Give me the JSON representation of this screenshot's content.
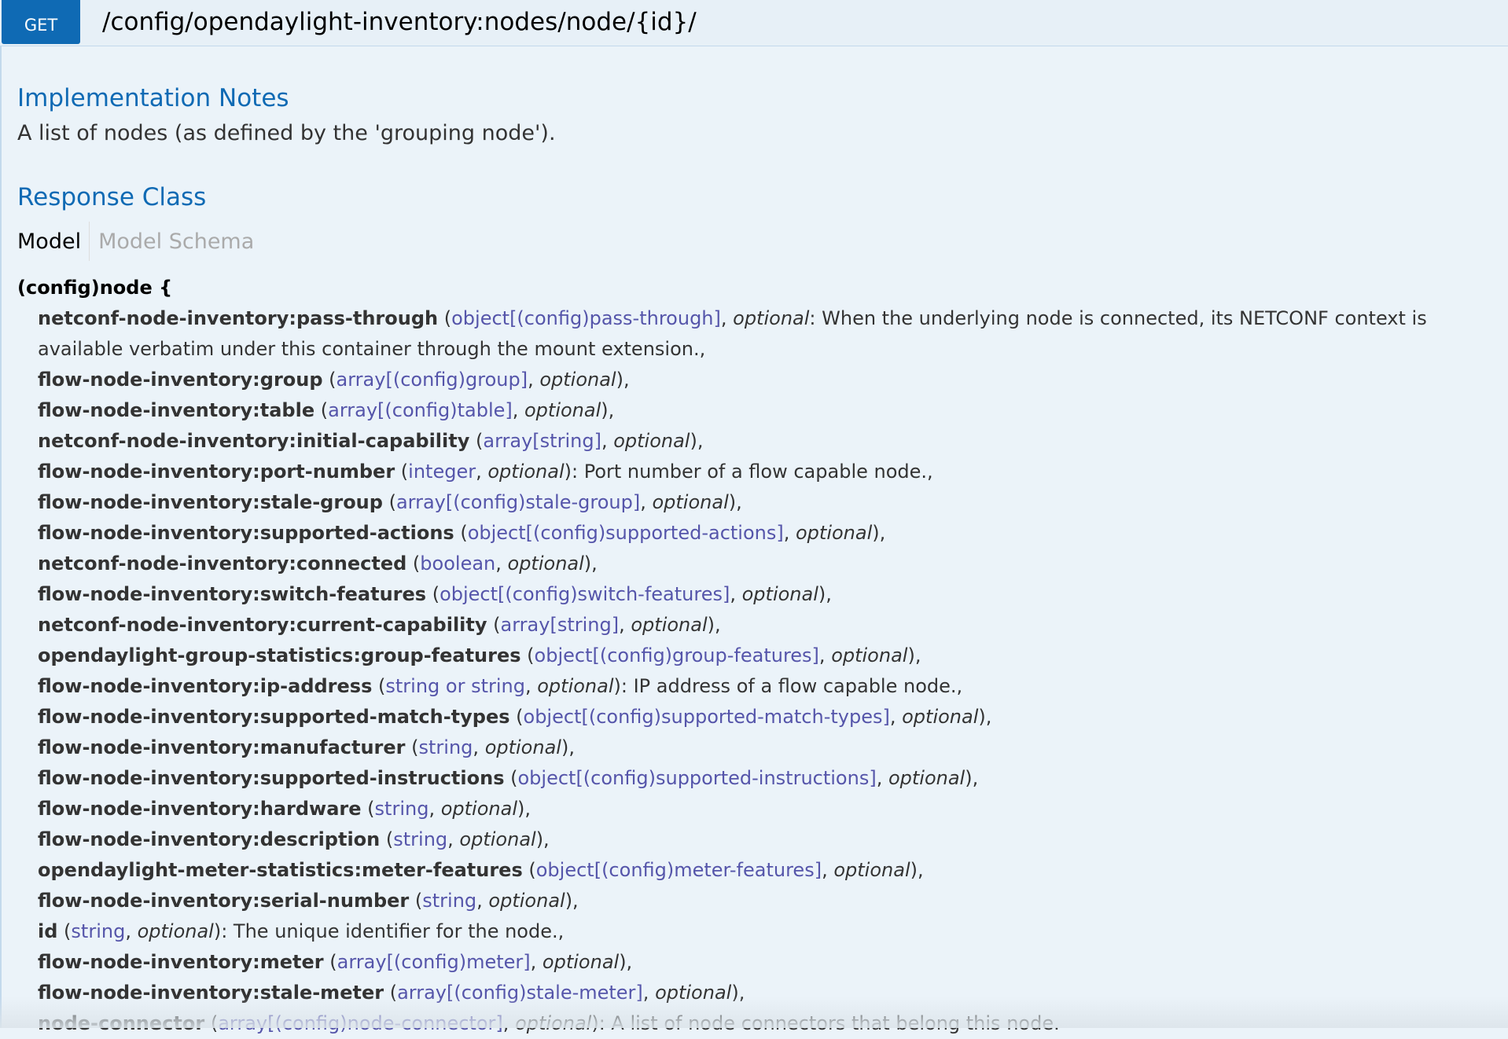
{
  "endpoint": {
    "method": "GET",
    "path": "/config/opendaylight-inventory:nodes/node/{id}/"
  },
  "implementation_notes": {
    "title": "Implementation Notes",
    "text": "A list of nodes (as defined by the 'grouping node')."
  },
  "response_class": {
    "title": "Response Class",
    "tabs": {
      "model": "Model",
      "schema": "Model Schema"
    },
    "model_header": "(config)node {",
    "properties": [
      {
        "name": "netconf-node-inventory:pass-through",
        "type": "object[(config)pass-through]",
        "optional": "optional",
        "description": ": When the underlying node is connected, its NETCONF context is available verbatim under this container through the mount extension.,"
      },
      {
        "name": "flow-node-inventory:group",
        "type": "array[(config)group]",
        "optional": "optional",
        "description": "),"
      },
      {
        "name": "flow-node-inventory:table",
        "type": "array[(config)table]",
        "optional": "optional",
        "description": "),"
      },
      {
        "name": "netconf-node-inventory:initial-capability",
        "type": "array[string]",
        "optional": "optional",
        "description": "),"
      },
      {
        "name": "flow-node-inventory:port-number",
        "type": "integer",
        "optional": "optional",
        "description": "): Port number of a flow capable node.,"
      },
      {
        "name": "flow-node-inventory:stale-group",
        "type": "array[(config)stale-group]",
        "optional": "optional",
        "description": "),"
      },
      {
        "name": "flow-node-inventory:supported-actions",
        "type": "object[(config)supported-actions]",
        "optional": "optional",
        "description": "),"
      },
      {
        "name": "netconf-node-inventory:connected",
        "type": "boolean",
        "optional": "optional",
        "description": "),"
      },
      {
        "name": "flow-node-inventory:switch-features",
        "type": "object[(config)switch-features]",
        "optional": "optional",
        "description": "),"
      },
      {
        "name": "netconf-node-inventory:current-capability",
        "type": "array[string]",
        "optional": "optional",
        "description": "),"
      },
      {
        "name": "opendaylight-group-statistics:group-features",
        "type": "object[(config)group-features]",
        "optional": "optional",
        "description": "),"
      },
      {
        "name": "flow-node-inventory:ip-address",
        "type": "string or string",
        "optional": "optional",
        "description": "): IP address of a flow capable node.,"
      },
      {
        "name": "flow-node-inventory:supported-match-types",
        "type": "object[(config)supported-match-types]",
        "optional": "optional",
        "description": "),"
      },
      {
        "name": "flow-node-inventory:manufacturer",
        "type": "string",
        "optional": "optional",
        "description": "),"
      },
      {
        "name": "flow-node-inventory:supported-instructions",
        "type": "object[(config)supported-instructions]",
        "optional": "optional",
        "description": "),"
      },
      {
        "name": "flow-node-inventory:hardware",
        "type": "string",
        "optional": "optional",
        "description": "),"
      },
      {
        "name": "flow-node-inventory:description",
        "type": "string",
        "optional": "optional",
        "description": "),"
      },
      {
        "name": "opendaylight-meter-statistics:meter-features",
        "type": "object[(config)meter-features]",
        "optional": "optional",
        "description": "),"
      },
      {
        "name": "flow-node-inventory:serial-number",
        "type": "string",
        "optional": "optional",
        "description": "),"
      },
      {
        "name": "id",
        "type": "string",
        "optional": "optional",
        "description": "): The unique identifier for the node.,"
      },
      {
        "name": "flow-node-inventory:meter",
        "type": "array[(config)meter]",
        "optional": "optional",
        "description": "),"
      },
      {
        "name": "flow-node-inventory:stale-meter",
        "type": "array[(config)stale-meter]",
        "optional": "optional",
        "description": "),"
      },
      {
        "name": "node-connector",
        "type": "array[(config)node-connector]",
        "optional": "optional",
        "description": "): A list of node connectors that belong this node."
      }
    ]
  }
}
